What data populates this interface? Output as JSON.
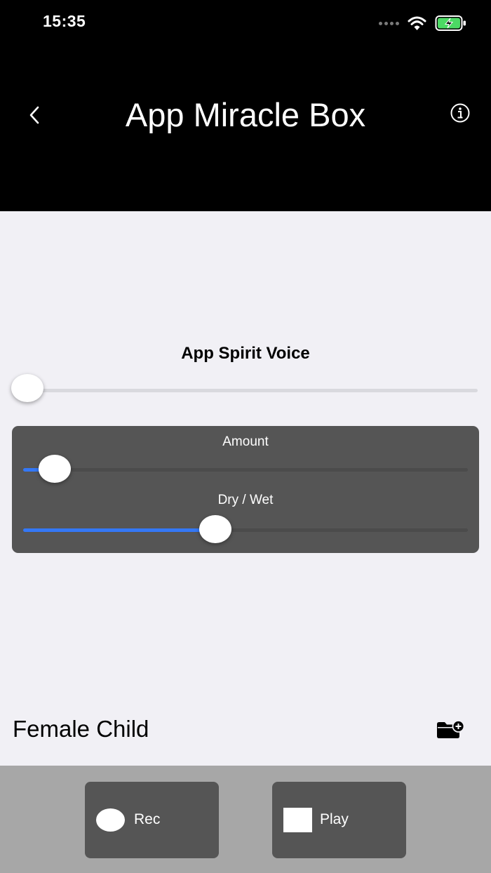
{
  "status_bar": {
    "time": "15:35"
  },
  "nav": {
    "title": "App Miracle Box",
    "back_icon": "chevron-left-icon",
    "info_icon": "info-icon"
  },
  "voice": {
    "title": "App Spirit Voice",
    "slider_value": 0
  },
  "effects": {
    "amount": {
      "label": "Amount",
      "value": 0.07
    },
    "dry_wet": {
      "label": "Dry / Wet",
      "value": 0.43
    },
    "accent_color": "#3478f6"
  },
  "preset": {
    "name": "Female Child",
    "folder_icon": "folder-add-icon"
  },
  "controls": {
    "rec_label": "Rec",
    "play_label": "Play"
  }
}
